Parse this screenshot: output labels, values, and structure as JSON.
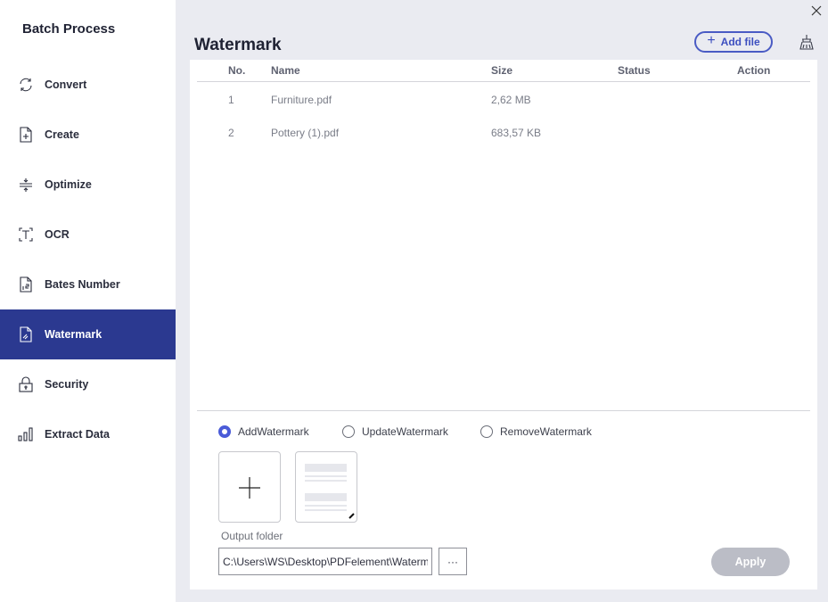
{
  "sidebar": {
    "title": "Batch Process",
    "items": [
      {
        "label": "Convert",
        "icon": "convert-icon",
        "active": false
      },
      {
        "label": "Create",
        "icon": "create-icon",
        "active": false
      },
      {
        "label": "Optimize",
        "icon": "optimize-icon",
        "active": false
      },
      {
        "label": "OCR",
        "icon": "ocr-icon",
        "active": false
      },
      {
        "label": "Bates Number",
        "icon": "bates-number-icon",
        "active": false
      },
      {
        "label": "Watermark",
        "icon": "watermark-icon",
        "active": true
      },
      {
        "label": "Security",
        "icon": "lock-icon",
        "active": false
      },
      {
        "label": "Extract Data",
        "icon": "bar-chart-icon",
        "active": false
      }
    ]
  },
  "header": {
    "title": "Watermark",
    "add_file_label": "Add file",
    "add_file_icon": "plus-icon",
    "clear_icon": "broom-icon",
    "close_icon": "close-icon"
  },
  "table": {
    "columns": [
      "No.",
      "Name",
      "Size",
      "Status",
      "Action"
    ],
    "rows": [
      {
        "no": "1",
        "name": "Furniture.pdf",
        "size": "2,62 MB",
        "status": "",
        "action": ""
      },
      {
        "no": "2",
        "name": "Pottery (1).pdf",
        "size": "683,57 KB",
        "status": "",
        "action": ""
      }
    ]
  },
  "options": {
    "modes": [
      {
        "label": "AddWatermark",
        "checked": true
      },
      {
        "label": "UpdateWatermark",
        "checked": false
      },
      {
        "label": "RemoveWatermark",
        "checked": false
      }
    ],
    "add_template_icon": "plus-icon",
    "template_edit_icon": "pencil-icon"
  },
  "output": {
    "label": "Output folder",
    "path": "C:\\Users\\WS\\Desktop\\PDFelement\\Waterm",
    "browse_label": "···",
    "apply_label": "Apply"
  },
  "colors": {
    "accent": "#2b3990",
    "button_outline": "#4a5bc4",
    "radio_checked": "#4a5bd8",
    "apply_disabled": "#bbbdc6",
    "background": "#eaebf1"
  }
}
